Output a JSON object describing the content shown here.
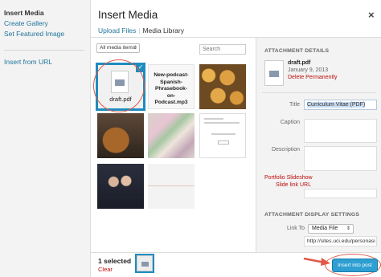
{
  "menu": {
    "items": [
      {
        "label": "Insert Media"
      },
      {
        "label": "Create Gallery"
      },
      {
        "label": "Set Featured Image"
      },
      {
        "label": "Insert from URL"
      }
    ]
  },
  "header": {
    "title": "Insert Media",
    "close_glyph": "×",
    "tabs": [
      {
        "label": "Upload Files"
      },
      {
        "label": "Media Library"
      }
    ]
  },
  "toolbar": {
    "filter_value": "All media items",
    "filter_arrow": "⇕",
    "search_placeholder": "Search"
  },
  "library": {
    "items": [
      {
        "name": "draft.pdf",
        "kind": "document",
        "selected": true
      },
      {
        "name": "New-podcast-Spanish-Phrasebook-on-Podcast.mp3",
        "display": [
          "New-podcast-",
          "Spanish-",
          "Phrasebook-",
          "on-",
          "Podcast.mp3"
        ],
        "kind": "audio"
      },
      {
        "kind": "image",
        "subject": "bread rolls"
      },
      {
        "kind": "image",
        "subject": "bread loaves"
      },
      {
        "kind": "image",
        "subject": "candy bags"
      },
      {
        "kind": "image",
        "subject": "document screenshot"
      },
      {
        "kind": "image",
        "subject": "two people"
      },
      {
        "kind": "image",
        "subject": "blank page"
      }
    ],
    "check_glyph": "✓"
  },
  "details": {
    "heading": "ATTACHMENT DETAILS",
    "filename": "draft.pdf",
    "date": "January 9, 2013",
    "delete_label": "Delete Permanently",
    "title_label": "Title",
    "title_value": "Curriculum Vitae (PDF)",
    "caption_label": "Caption",
    "description_label": "Description",
    "portfolio_line1": "Portfolio Slideshow",
    "portfolio_line2": "Slide link URL",
    "display_heading": "ATTACHMENT DISPLAY SETTINGS",
    "link_to_label": "Link To",
    "link_to_value": "Media File",
    "link_to_arrow": "⇕",
    "url_value": "http://sites.uci.edu/personasi"
  },
  "footer": {
    "selected_count": "1 selected",
    "clear_label": "Clear",
    "insert_label": "Insert into post"
  },
  "colors": {
    "link": "#21759b",
    "danger": "#bc0b0b",
    "selection": "#1e8cbe",
    "primary_button": "#2e9fd2",
    "annotation": "#e05a4a"
  }
}
